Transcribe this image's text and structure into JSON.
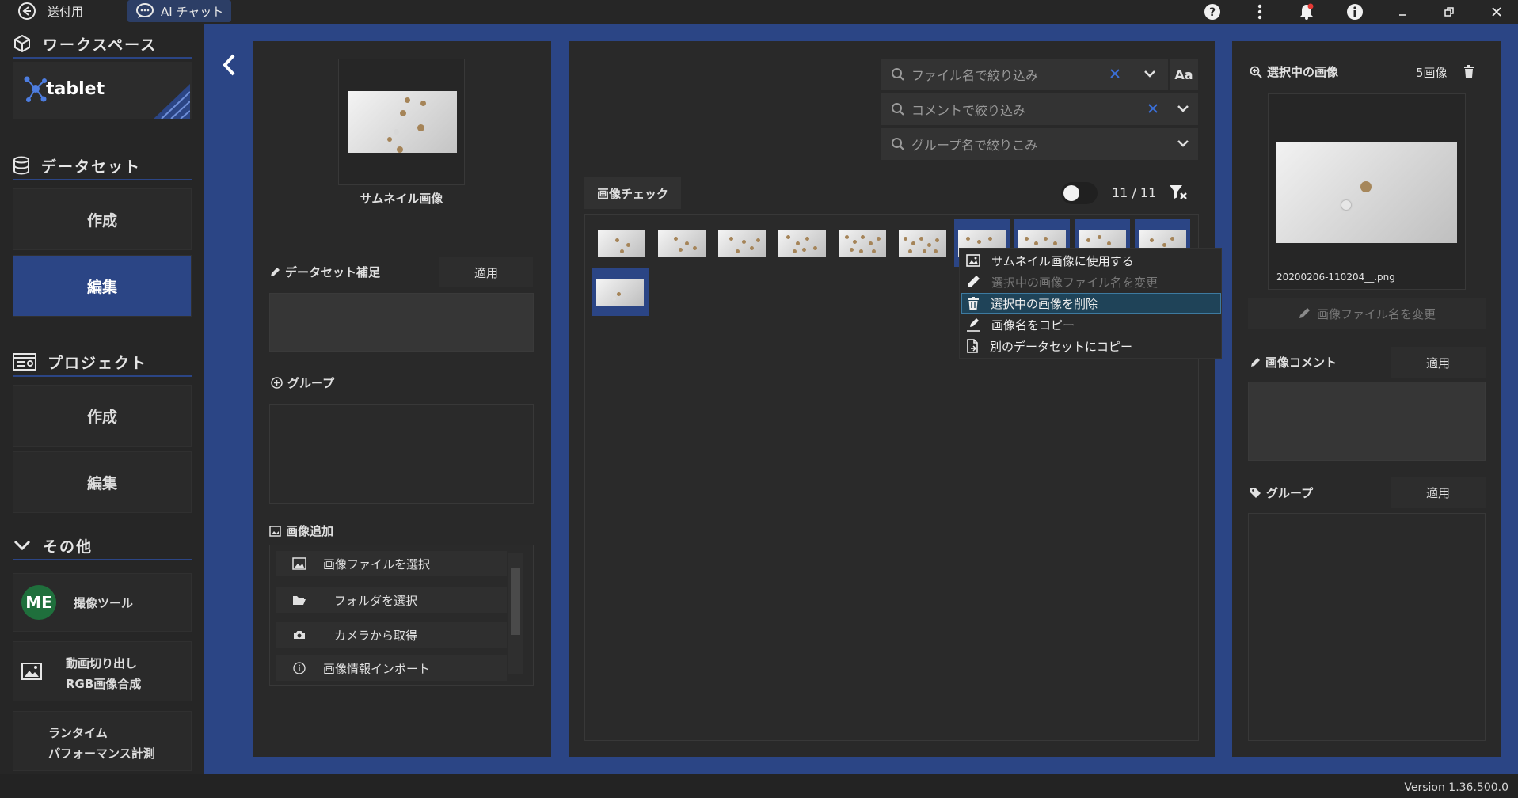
{
  "titlebar": {
    "back_label": "送付用",
    "ai_chat_label": "AI チャット"
  },
  "sidebar": {
    "workspace": {
      "header": "ワークスペース",
      "name": "tablet"
    },
    "dataset": {
      "header": "データセット",
      "create": "作成",
      "edit": "編集"
    },
    "project": {
      "header": "プロジェクト",
      "create": "作成",
      "edit": "編集"
    },
    "others": {
      "header": "その他",
      "capture_tool": "撮像ツール",
      "capture_logo": "ME",
      "video_line1": "動画切り出し",
      "video_line2": "RGB画像合成",
      "runtime_line1": "ランタイム",
      "runtime_line2": "パフォーマンス計測"
    }
  },
  "left_panel": {
    "thumbnail_label": "サムネイル画像",
    "supplement_label": "データセット補足",
    "apply": "適用",
    "group_label": "グループ",
    "add_images_label": "画像追加",
    "add_items": [
      "画像ファイルを選択",
      "フォルダを選択",
      "カメラから取得",
      "画像情報インポート"
    ]
  },
  "center": {
    "filter_filename_placeholder": "ファイル名で絞り込み",
    "filter_comment_placeholder": "コメントで絞り込み",
    "filter_group_placeholder": "グループ名で絞りこみ",
    "case_button": "Aa",
    "tab_label": "画像チェック",
    "count": "11 / 11"
  },
  "context_menu": {
    "items": [
      "サムネイル画像に使用する",
      "選択中の画像ファイル名を変更",
      "選択中の画像を削除",
      "画像名をコピー",
      "別のデータセットにコピー"
    ]
  },
  "right_panel": {
    "selected_label": "選択中の画像",
    "selected_count": "5画像",
    "filename": "20200206-110204__.png",
    "rename_button": "画像ファイル名を変更",
    "comment_label": "画像コメント",
    "apply": "適用",
    "group_label": "グループ"
  },
  "version": "Version 1.36.500.0",
  "colors": {
    "accent": "#2b4585",
    "panel": "#292929",
    "background": "#232323"
  }
}
